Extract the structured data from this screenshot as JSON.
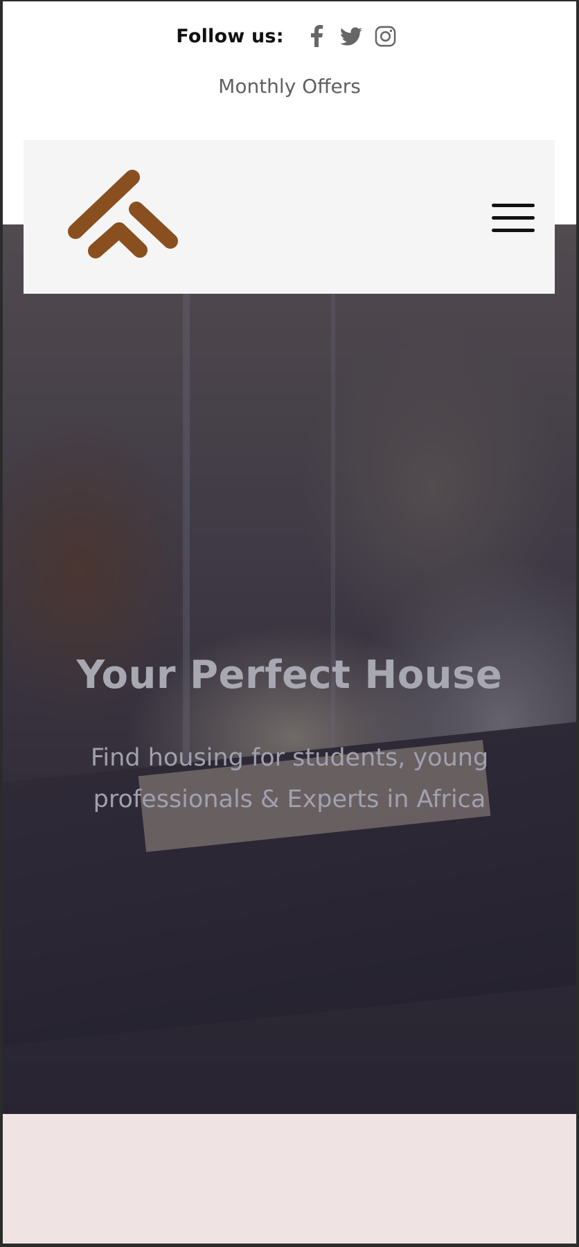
{
  "header": {
    "follow_label": "Follow us:",
    "social_icons": [
      "facebook-icon",
      "twitter-icon",
      "instagram-icon"
    ],
    "offers_link": "Monthly Offers"
  },
  "navbar": {
    "logo_icon": "house-chevron-logo",
    "menu_icon": "hamburger-menu-icon"
  },
  "hero": {
    "title": "Your Perfect House",
    "subtitle": "Find housing for students, young professionals & Experts in Africa"
  },
  "colors": {
    "brand_brown": "#8a4f1f",
    "nav_background": "#f5f5f5",
    "footer_band": "#f0e3e4",
    "hero_overlay": "#282842"
  }
}
